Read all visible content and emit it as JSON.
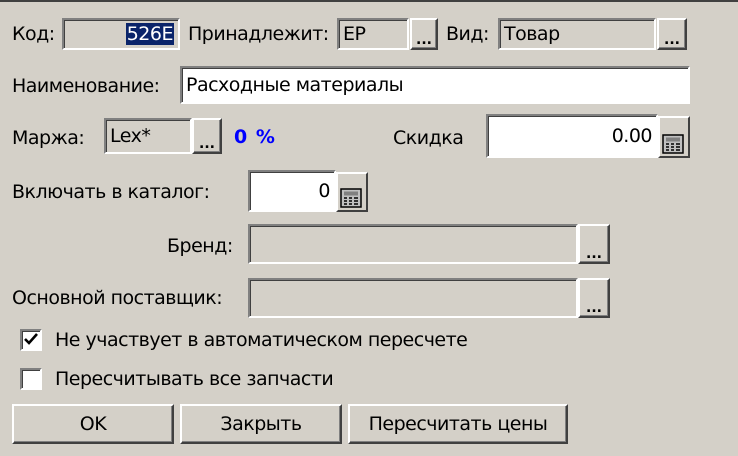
{
  "code": {
    "label": "Код:",
    "value": "526E"
  },
  "owner": {
    "label": "Принадлежит:",
    "value": "EP"
  },
  "kind": {
    "label": "Вид:",
    "value": "Товар"
  },
  "name": {
    "label": "Наименование:",
    "value": "Расходные материалы"
  },
  "margin": {
    "label": "Маржа:",
    "value": "Lex*",
    "percent": "0 %",
    "percent_color": "#0000ff"
  },
  "discount": {
    "label": "Скидка",
    "value": "0.00"
  },
  "catalog": {
    "label": "Включать в каталог:",
    "value": "0"
  },
  "brand": {
    "label": "Бренд:",
    "value": ""
  },
  "supplier": {
    "label": "Основной поставщик:",
    "value": ""
  },
  "browse_label": "...",
  "checkboxes": [
    {
      "label": "Не участвует в автоматическом пересчете",
      "checked": true
    },
    {
      "label": "Пересчитывать все запчасти",
      "checked": false
    }
  ],
  "buttons": {
    "ok": "OK",
    "close": "Закрыть",
    "recalc": "Пересчитать цены"
  }
}
